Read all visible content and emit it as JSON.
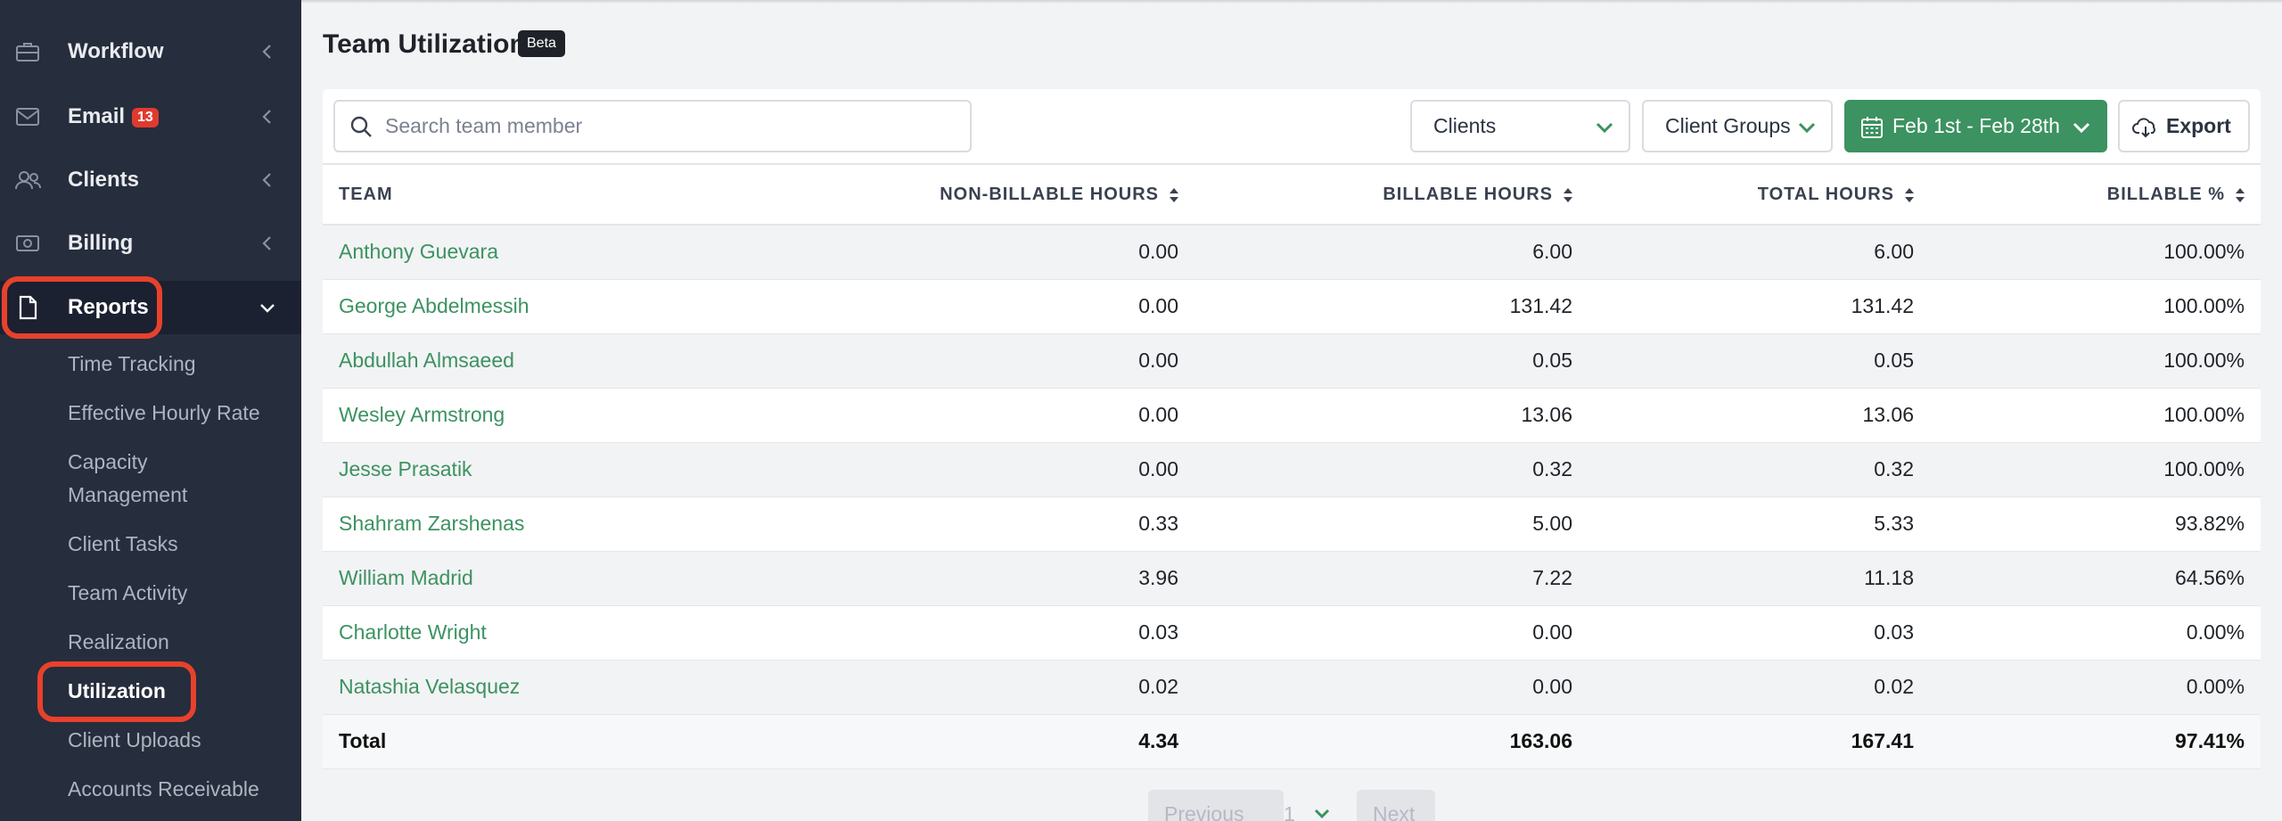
{
  "sidebar": {
    "items": [
      {
        "label": "Workflow",
        "icon": "briefcase-icon"
      },
      {
        "label": "Email",
        "icon": "mail-icon",
        "badge": "13"
      },
      {
        "label": "Clients",
        "icon": "users-icon"
      },
      {
        "label": "Billing",
        "icon": "money-icon"
      },
      {
        "label": "Reports",
        "icon": "document-icon",
        "active": true
      }
    ],
    "sub_items": [
      "Time Tracking",
      "Effective Hourly Rate",
      "Capacity",
      "Management",
      "Client Tasks",
      "Team Activity",
      "Realization",
      "Utilization",
      "Client Uploads",
      "Accounts Receivable"
    ],
    "active_sub_item": "Utilization"
  },
  "header": {
    "title": "Team Utilization",
    "badge": "Beta"
  },
  "toolbar": {
    "search_placeholder": "Search team member",
    "clients_label": "Clients",
    "client_groups_label": "Client Groups",
    "date_range_label": "Feb 1st - Feb 28th",
    "export_label": "Export"
  },
  "table": {
    "columns": [
      "TEAM",
      "NON-BILLABLE HOURS",
      "BILLABLE HOURS",
      "TOTAL HOURS",
      "BILLABLE %"
    ],
    "rows": [
      [
        "Anthony Guevara",
        "0.00",
        "6.00",
        "6.00",
        "100.00%"
      ],
      [
        "George Abdelmessih",
        "0.00",
        "131.42",
        "131.42",
        "100.00%"
      ],
      [
        "Abdullah Almsaeed",
        "0.00",
        "0.05",
        "0.05",
        "100.00%"
      ],
      [
        "Wesley Armstrong",
        "0.00",
        "13.06",
        "13.06",
        "100.00%"
      ],
      [
        "Jesse Prasatik",
        "0.00",
        "0.32",
        "0.32",
        "100.00%"
      ],
      [
        "Shahram Zarshenas",
        "0.33",
        "5.00",
        "5.33",
        "93.82%"
      ],
      [
        "William Madrid",
        "3.96",
        "7.22",
        "11.18",
        "64.56%"
      ],
      [
        "Charlotte Wright",
        "0.03",
        "0.00",
        "0.03",
        "0.00%"
      ],
      [
        "Natashia Velasquez",
        "0.02",
        "0.00",
        "0.02",
        "0.00%"
      ]
    ],
    "total": [
      "Total",
      "4.34",
      "163.06",
      "167.41",
      "97.41%"
    ]
  },
  "pagination": {
    "previous_label": "Previous",
    "page": "1",
    "next_label": "Next"
  },
  "colors": {
    "sidebar_bg": "#262d3c",
    "accent_green": "#3c9260",
    "highlight_red": "#e8412c"
  }
}
